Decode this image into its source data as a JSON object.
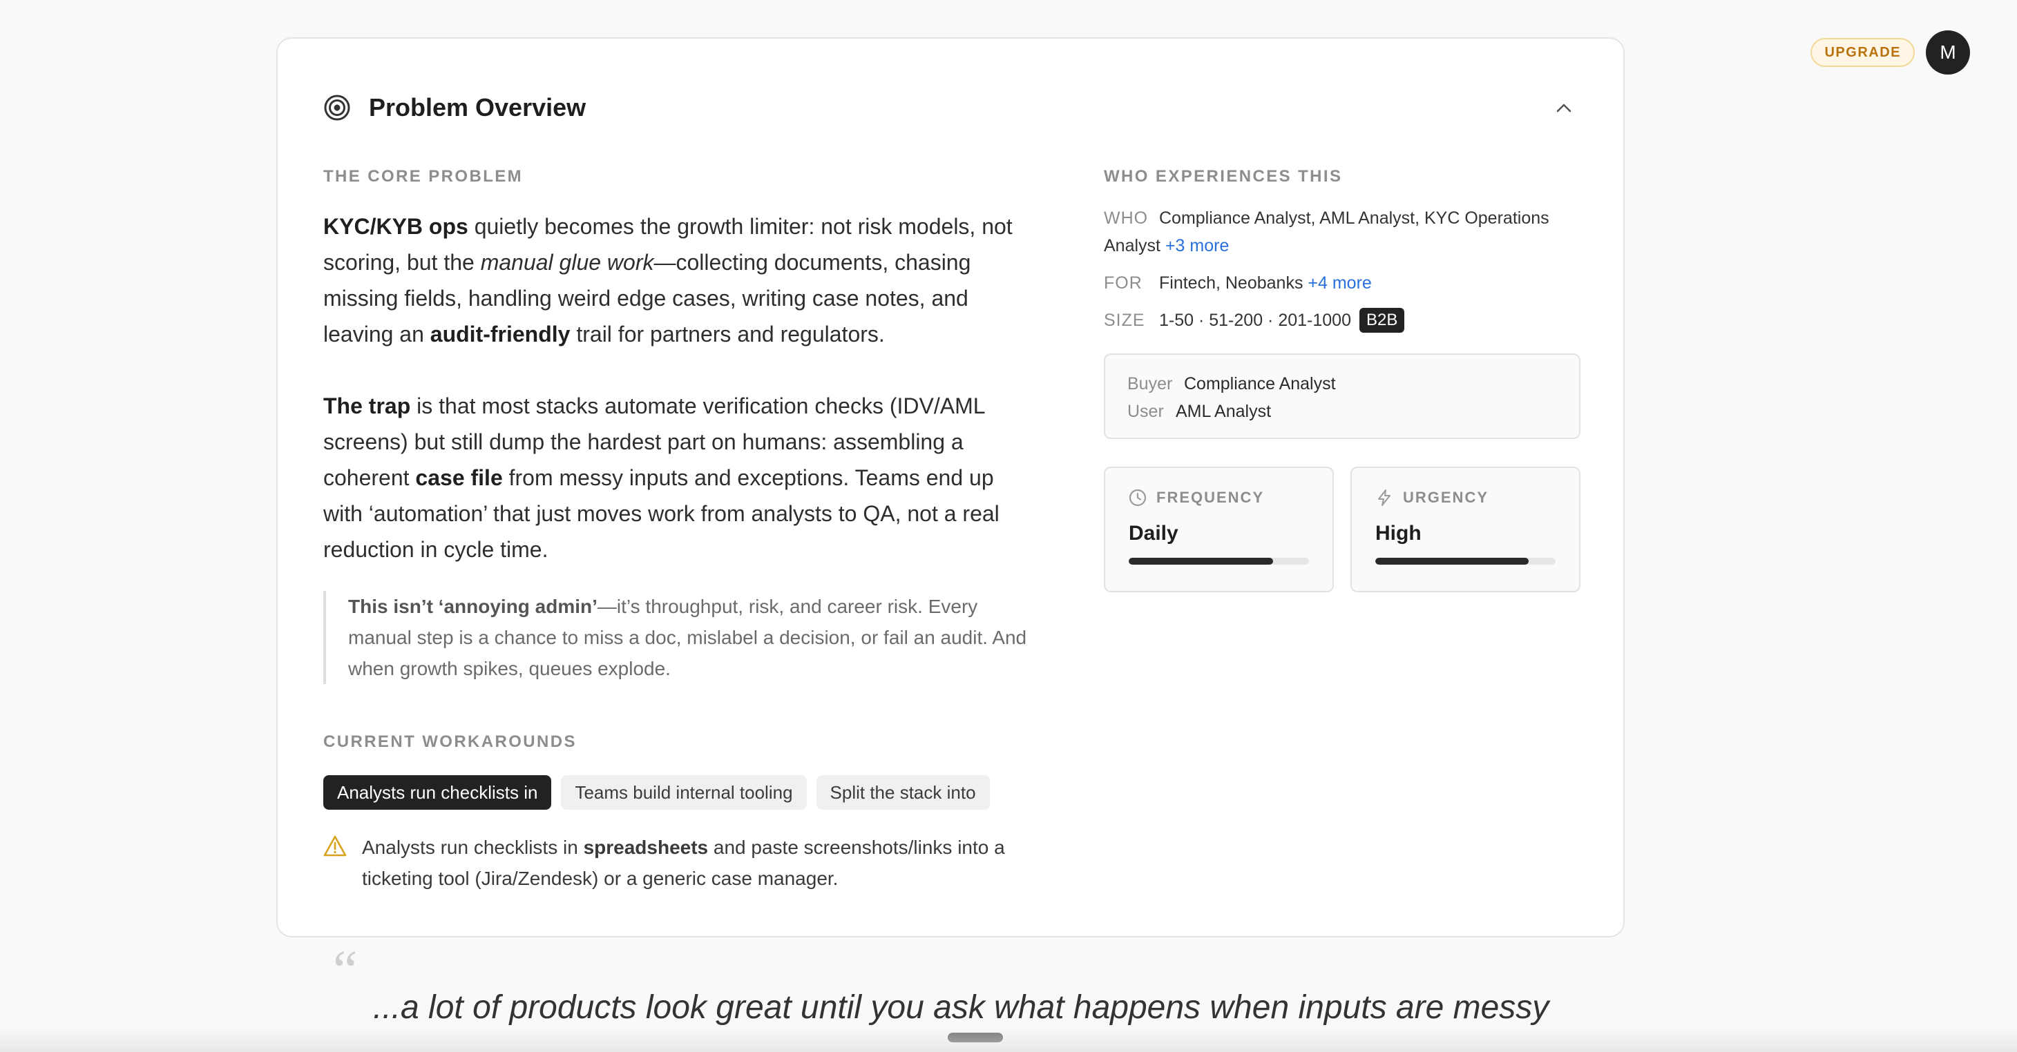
{
  "topbar": {
    "upgrade_label": "UPGRADE",
    "avatar_initial": "M"
  },
  "card": {
    "title": "Problem Overview",
    "core_problem": {
      "label": "THE CORE PROBLEM",
      "p1": {
        "b1": "KYC/KYB ops",
        "t1": " quietly becomes the growth limiter: not risk models, not scoring, but the ",
        "i1": "manual glue work",
        "t2": "—collecting documents, chasing missing fields, handling weird edge cases, writing case notes, and leaving an ",
        "b2": "audit-friendly",
        "t3": " trail for partners and regulators."
      },
      "p2": {
        "b1": "The trap",
        "t1": " is that most stacks automate verification checks (IDV/AML screens) but still dump the hardest part on humans: assembling a coherent ",
        "b2": "case file",
        "t2": " from messy inputs and exceptions. Teams end up with ‘automation’ that just moves work from analysts to QA, not a real reduction in cycle time."
      },
      "quote": {
        "b1": "This isn’t ‘annoying admin’",
        "t1": "—it’s throughput, risk, and career risk. Every manual step is a chance to miss a doc, mislabel a decision, or fail an audit. And when growth spikes, queues explode."
      }
    },
    "workarounds": {
      "label": "CURRENT WORKAROUNDS",
      "chips": [
        "Analysts run checklists in",
        "Teams build internal tooling",
        "Split the stack into"
      ],
      "detail": {
        "t1": "Analysts run checklists in ",
        "b1": "spreadsheets",
        "t2": " and paste screenshots/links into a ticketing tool (Jira/Zendesk) or a generic case manager."
      }
    },
    "who": {
      "label": "WHO EXPERIENCES THIS",
      "who_key": "WHO",
      "who_value": "Compliance Analyst, AML Analyst, KYC Operations Analyst",
      "who_more": "+3 more",
      "for_key": "FOR",
      "for_value": "Fintech, Neobanks",
      "for_more": "+4 more",
      "size_key": "SIZE",
      "size_value": "1-50 · 51-200 · 201-1000",
      "size_badge": "B2B"
    },
    "roles": {
      "buyer_key": "Buyer",
      "buyer_value": "Compliance Analyst",
      "user_key": "User",
      "user_value": "AML Analyst"
    },
    "metrics": {
      "frequency": {
        "label": "FREQUENCY",
        "value": "Daily",
        "level": 0.8
      },
      "urgency": {
        "label": "URGENCY",
        "value": "High",
        "level": 0.85
      }
    }
  },
  "testimonial": {
    "mark": "“",
    "text": "...a lot of products look great until you ask what happens when inputs are messy"
  }
}
